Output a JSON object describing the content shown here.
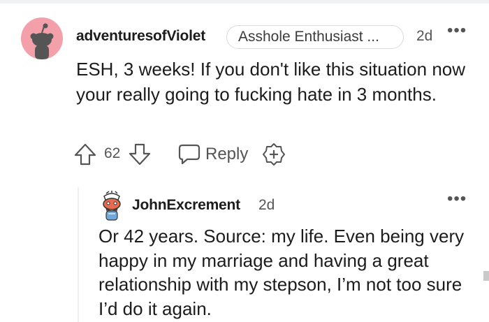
{
  "comments": [
    {
      "username": "adventuresofViolet",
      "flair": "Asshole Enthusiast ...",
      "time": "2d",
      "more": "•••",
      "body": "ESH, 3 weeks! If you don't like this situation now your really going to fucking hate in 3 months.",
      "score": "62",
      "reply_label": "Reply",
      "avatar_color": "#f3a0ab"
    },
    {
      "username": "JohnExcrement",
      "time": "2d",
      "more": "•••",
      "body": "Or 42 years. Source: my life. Even being very happy in my marriage and having a great relationship with my stepson, I’m not too sure I’d do it again."
    }
  ],
  "icons": {
    "upvote": "upvote-arrow-icon",
    "downvote": "downvote-arrow-icon",
    "reply": "speech-bubble-icon",
    "award": "award-plus-icon"
  }
}
